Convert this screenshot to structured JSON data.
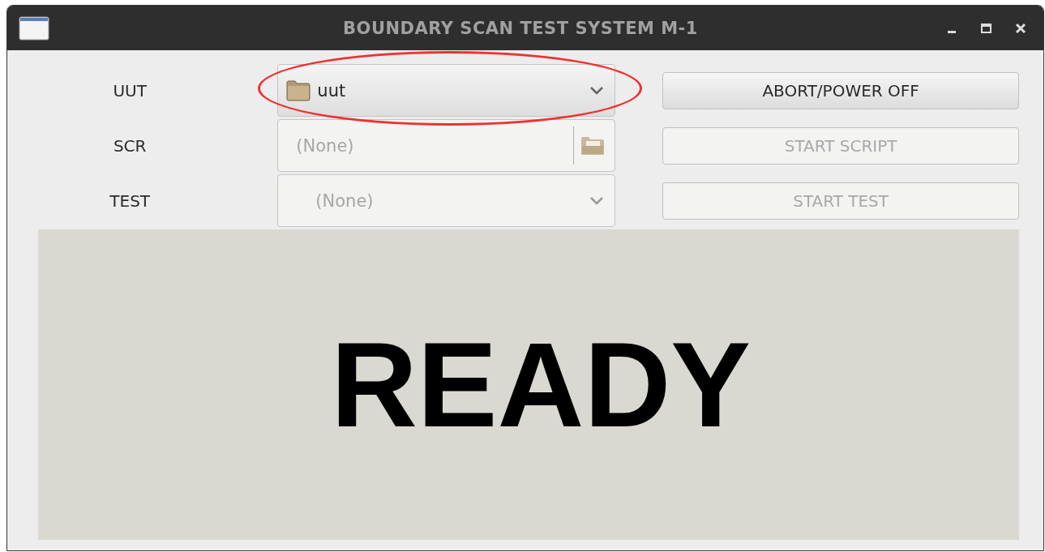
{
  "window": {
    "title": "BOUNDARY SCAN TEST SYSTEM M-1"
  },
  "rows": [
    {
      "label": "UUT",
      "field": {
        "kind": "folder-combo",
        "value": "uut",
        "disabled": false
      }
    },
    {
      "label": "SCR",
      "field": {
        "kind": "file-chooser",
        "value": "(None)",
        "disabled": true
      }
    },
    {
      "label": "TEST",
      "field": {
        "kind": "combo",
        "value": "(None)",
        "disabled": true
      }
    }
  ],
  "buttons": [
    {
      "label": "ABORT/POWER OFF",
      "disabled": false
    },
    {
      "label": "START SCRIPT",
      "disabled": true
    },
    {
      "label": "START TEST",
      "disabled": true
    }
  ],
  "status": {
    "text": "READY"
  }
}
